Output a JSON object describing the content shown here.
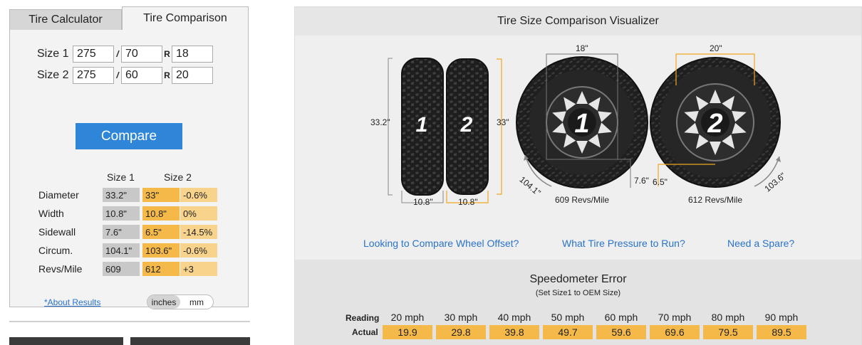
{
  "tabs": [
    {
      "label": "Tire Calculator",
      "active": false
    },
    {
      "label": "Tire Comparison",
      "active": true
    }
  ],
  "sizes": [
    {
      "label": "Size 1",
      "width": "275",
      "ratio": "70",
      "rim": "18"
    },
    {
      "label": "Size 2",
      "width": "275",
      "ratio": "60",
      "rim": "20"
    }
  ],
  "slash": "/",
  "rim_prefix": "R",
  "compare_label": "Compare",
  "results": {
    "col1": "Size 1",
    "col2": "Size 2",
    "rows": [
      {
        "label": "Diameter",
        "v1": "33.2\"",
        "v2": "33\"",
        "diff": "-0.6%"
      },
      {
        "label": "Width",
        "v1": "10.8\"",
        "v2": "10.8\"",
        "diff": "0%"
      },
      {
        "label": "Sidewall",
        "v1": "7.6\"",
        "v2": "6.5\"",
        "diff": "-14.5%"
      },
      {
        "label": "Circum.",
        "v1": "104.1\"",
        "v2": "103.6\"",
        "diff": "-0.6%"
      },
      {
        "label": "Revs/Mile",
        "v1": "609",
        "v2": "612",
        "diff": "+3"
      }
    ]
  },
  "about_link": "*About Results",
  "units": {
    "inches": "inches",
    "mm": "mm",
    "selected": "inches"
  },
  "visualizer": {
    "title": "Tire Size Comparison Visualizer",
    "tire1_number": "1",
    "tire2_number": "2",
    "tire1_height": "33.2\"",
    "tire2_height": "33\"",
    "tire1_width": "10.8\"",
    "tire2_width": "10.8\"",
    "wheel1_rim": "18\"",
    "wheel2_rim": "20\"",
    "wheel1_sidewall": "7.6\"",
    "wheel2_sidewall": "6.5\"",
    "wheel1_circum": "104.1\"",
    "wheel2_circum": "103.6\"",
    "wheel1_revs": "609 Revs/Mile",
    "wheel2_revs": "612 Revs/Mile"
  },
  "links": [
    "Looking to Compare Wheel Offset?",
    "What Tire Pressure to Run?",
    "Need a Spare?"
  ],
  "speedometer": {
    "title": "Speedometer Error",
    "subtitle": "(Set Size1 to OEM Size)",
    "reading_label": "Reading",
    "actual_label": "Actual",
    "readings": [
      "20 mph",
      "30 mph",
      "40 mph",
      "50 mph",
      "60 mph",
      "70 mph",
      "80 mph",
      "90 mph"
    ],
    "actuals": [
      "19.9",
      "29.8",
      "39.8",
      "49.7",
      "59.6",
      "69.6",
      "79.5",
      "89.5"
    ]
  },
  "colors": {
    "accent": "#2f86d8",
    "highlight": "#f5b94a",
    "highlight_light": "#f7d38c",
    "grey_cell": "#c8c8c8",
    "link": "#2a73c9"
  }
}
